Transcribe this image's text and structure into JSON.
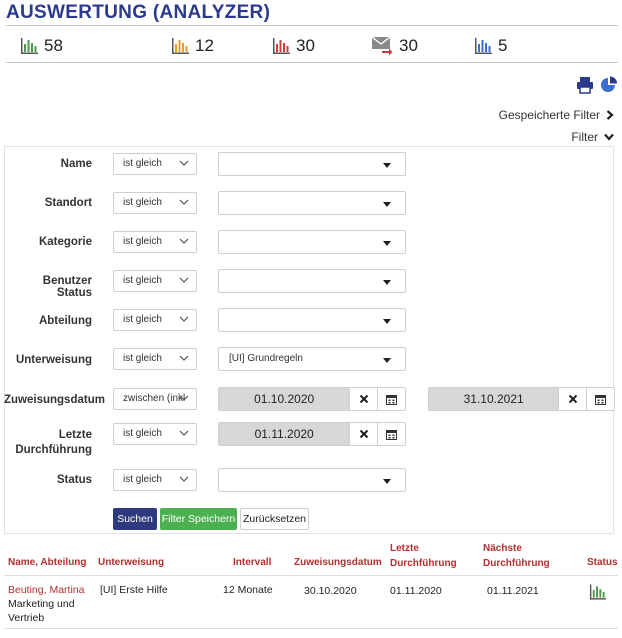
{
  "header": {
    "title": "AUSWERTUNG (ANALYZER)"
  },
  "stats": [
    {
      "icon": "bar-chart-green-icon",
      "value": "58"
    },
    {
      "icon": "bar-chart-orange-icon",
      "value": "12"
    },
    {
      "icon": "bar-chart-red-icon",
      "value": "30"
    },
    {
      "icon": "mail-forward-icon",
      "value": "30"
    },
    {
      "icon": "bar-chart-blue-icon",
      "value": "5"
    }
  ],
  "links": {
    "saved_filters": "Gespeicherte Filter",
    "filter": "Filter"
  },
  "filters": {
    "name": {
      "label": "Name",
      "op": "ist gleich",
      "value": ""
    },
    "standort": {
      "label": "Standort",
      "op": "ist gleich",
      "value": ""
    },
    "kategorie": {
      "label": "Kategorie",
      "op": "ist gleich",
      "value": ""
    },
    "benutzer_status": {
      "label": "Benutzer Status",
      "op": "ist gleich",
      "value": ""
    },
    "abteilung": {
      "label": "Abteilung",
      "op": "ist gleich",
      "value": ""
    },
    "unterweisung": {
      "label": "Unterweisung",
      "op": "ist gleich",
      "value": "[UI] Grundregeln"
    },
    "zuweisungsdatum": {
      "label": "Zuweisungsdatum",
      "op": "zwischen (inkl",
      "from": "01.10.2020",
      "to": "31.10.2021"
    },
    "letzte": {
      "label_line1": "Letzte",
      "label_line2": "Durchführung",
      "op": "ist gleich",
      "value": "01.11.2020"
    },
    "status": {
      "label": "Status",
      "op": "ist gleich",
      "value": ""
    }
  },
  "buttons": {
    "search": "Suchen",
    "save": "Filter Speichern",
    "reset": "Zurücksetzen"
  },
  "table": {
    "headers": {
      "name": "Name, Abteilung",
      "unterweisung": "Unterweisung",
      "intervall": "Intervall",
      "zuweisungsdatum": "Zuweisungsdatum",
      "letzte_1": "Letzte",
      "letzte_2": "Durchführung",
      "naechste_1": "Nächste",
      "naechste_2": "Durchführung",
      "status": "Status"
    },
    "rows": [
      {
        "name": "Beuting, Martina",
        "abteilung_1": "Marketing und",
        "abteilung_2": "Vertrieb",
        "unterweisung": "[UI] Erste Hilfe",
        "intervall": "12 Monate",
        "zuweisungsdatum": "30.10.2020",
        "letzte": "01.11.2020",
        "naechste": "01.11.2021",
        "status_icon": "bar-chart-green-icon"
      }
    ]
  },
  "colors": {
    "title": "#2b3a8c",
    "accent_red": "#b03030",
    "search_btn": "#2f3a7e",
    "save_btn": "#4cb050"
  }
}
